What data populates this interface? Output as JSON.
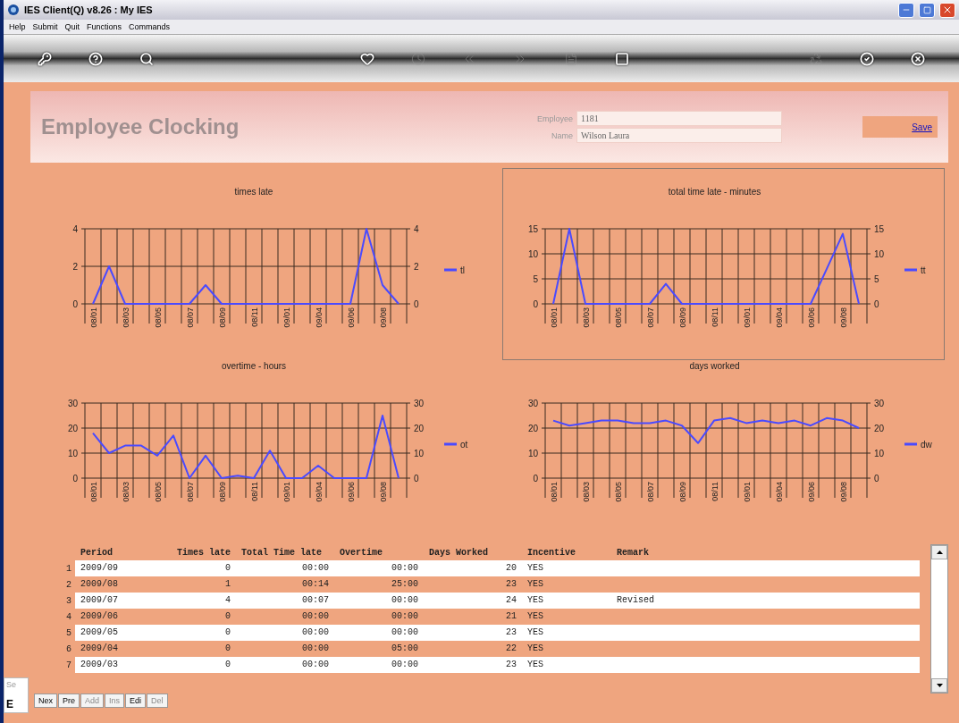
{
  "window": {
    "title": "IES Client(Q) v8.26 : My IES"
  },
  "menu": [
    "Help",
    "Submit",
    "Quit",
    "Functions",
    "Commands"
  ],
  "toolbar": [
    {
      "kind": "key",
      "disabled": false
    },
    {
      "kind": "help",
      "disabled": false
    },
    {
      "kind": "search",
      "disabled": false
    },
    {
      "kind": "heart",
      "disabled": false
    },
    {
      "kind": "clock",
      "disabled": true
    },
    {
      "kind": "back",
      "disabled": true
    },
    {
      "kind": "forward",
      "disabled": true
    },
    {
      "kind": "file",
      "disabled": true
    },
    {
      "kind": "stop",
      "disabled": false
    },
    {
      "kind": "recycle",
      "disabled": true
    },
    {
      "kind": "check",
      "disabled": false
    },
    {
      "kind": "close",
      "disabled": false
    }
  ],
  "header": {
    "title": "Employee Clocking",
    "fields": [
      {
        "label": "Employee",
        "value": "1181"
      },
      {
        "label": "Name",
        "value": "Wilson Laura"
      }
    ],
    "save": "Save"
  },
  "charts": [
    {
      "selected": false,
      "chart_data": {
        "type": "line",
        "title": "times late",
        "categories": [
          "08/01",
          null,
          "08/03",
          null,
          "08/05",
          null,
          "08/07",
          null,
          "08/09",
          null,
          "08/11",
          null,
          "09/01",
          null,
          "09/04",
          null,
          "09/06",
          null,
          "09/08",
          null
        ],
        "ylim": [
          0,
          4
        ],
        "yticks": [
          0,
          2,
          4
        ],
        "y2lim": [
          0,
          4
        ],
        "y2ticks": [
          0,
          2,
          4
        ],
        "series": [
          {
            "name": "tl",
            "color": "#4a4aff",
            "values": [
              0,
              2,
              0,
              0,
              0,
              0,
              0,
              1,
              0,
              0,
              0,
              0,
              0,
              0,
              0,
              0,
              0,
              4,
              1,
              0
            ]
          }
        ]
      }
    },
    {
      "selected": true,
      "chart_data": {
        "type": "line",
        "title": "total time late - minutes",
        "categories": [
          "08/01",
          null,
          "08/03",
          null,
          "08/05",
          null,
          "08/07",
          null,
          "08/09",
          null,
          "08/11",
          null,
          "09/01",
          null,
          "09/04",
          null,
          "09/06",
          null,
          "09/08",
          null
        ],
        "ylim": [
          0,
          15
        ],
        "yticks": [
          0,
          5,
          10,
          15
        ],
        "y2lim": [
          0,
          15
        ],
        "y2ticks": [
          0,
          5,
          10,
          15
        ],
        "series": [
          {
            "name": "tt",
            "color": "#4a4aff",
            "values": [
              0,
              15,
              0,
              0,
              0,
              0,
              0,
              4,
              0,
              0,
              0,
              0,
              0,
              0,
              0,
              0,
              0,
              7,
              14,
              0
            ]
          }
        ]
      }
    },
    {
      "selected": false,
      "chart_data": {
        "type": "line",
        "title": "overtime - hours",
        "categories": [
          "08/01",
          null,
          "08/03",
          null,
          "08/05",
          null,
          "08/07",
          null,
          "08/09",
          null,
          "08/11",
          null,
          "09/01",
          null,
          "09/04",
          null,
          "09/06",
          null,
          "09/08",
          null
        ],
        "ylim": [
          0,
          30
        ],
        "yticks": [
          0,
          10,
          20,
          30
        ],
        "y2lim": [
          0,
          30
        ],
        "y2ticks": [
          0,
          10,
          20,
          30
        ],
        "series": [
          {
            "name": "ot",
            "color": "#4a4aff",
            "values": [
              18,
              10,
              13,
              13,
              9,
              17,
              0,
              9,
              0,
              1,
              0,
              11,
              0,
              0,
              5,
              0,
              0,
              0,
              25,
              0
            ]
          }
        ]
      }
    },
    {
      "selected": false,
      "chart_data": {
        "type": "line",
        "title": "days worked",
        "categories": [
          "08/01",
          null,
          "08/03",
          null,
          "08/05",
          null,
          "08/07",
          null,
          "08/09",
          null,
          "08/11",
          null,
          "09/01",
          null,
          "09/04",
          null,
          "09/06",
          null,
          "09/08",
          null
        ],
        "ylim": [
          0,
          30
        ],
        "yticks": [
          0,
          10,
          20,
          30
        ],
        "y2lim": [
          0,
          30
        ],
        "y2ticks": [
          0,
          10,
          20,
          30
        ],
        "series": [
          {
            "name": "dw",
            "color": "#4a4aff",
            "values": [
              23,
              21,
              22,
              23,
              23,
              22,
              22,
              23,
              21,
              14,
              23,
              24,
              22,
              23,
              22,
              23,
              21,
              24,
              23,
              20
            ]
          }
        ]
      }
    }
  ],
  "table": {
    "columns": [
      "Period",
      "Times late",
      "Total Time late",
      "Overtime",
      "Days Worked",
      "Incentive",
      "Remark"
    ],
    "rows": [
      {
        "number": "1",
        "cells": [
          "2009/09",
          "0",
          "00:00",
          "00:00",
          "20",
          "YES",
          ""
        ]
      },
      {
        "number": "2",
        "cells": [
          "2009/08",
          "1",
          "00:14",
          "25:00",
          "23",
          "YES",
          ""
        ]
      },
      {
        "number": "3",
        "cells": [
          "2009/07",
          "4",
          "00:07",
          "00:00",
          "24",
          "YES",
          "Revised"
        ]
      },
      {
        "number": "4",
        "cells": [
          "2009/06",
          "0",
          "00:00",
          "00:00",
          "21",
          "YES",
          ""
        ]
      },
      {
        "number": "5",
        "cells": [
          "2009/05",
          "0",
          "00:00",
          "00:00",
          "23",
          "YES",
          ""
        ]
      },
      {
        "number": "6",
        "cells": [
          "2009/04",
          "0",
          "00:00",
          "05:00",
          "22",
          "YES",
          ""
        ]
      },
      {
        "number": "7",
        "cells": [
          "2009/03",
          "0",
          "00:00",
          "00:00",
          "23",
          "YES",
          ""
        ]
      }
    ]
  },
  "side_tab": {
    "label": "Se",
    "letter": "E"
  },
  "buttons": [
    {
      "label": "Nex",
      "disabled": false
    },
    {
      "label": "Pre",
      "disabled": false
    },
    {
      "label": "Add",
      "disabled": true
    },
    {
      "label": "Ins",
      "disabled": true
    },
    {
      "label": "Edi",
      "disabled": false
    },
    {
      "label": "Del",
      "disabled": true
    }
  ]
}
